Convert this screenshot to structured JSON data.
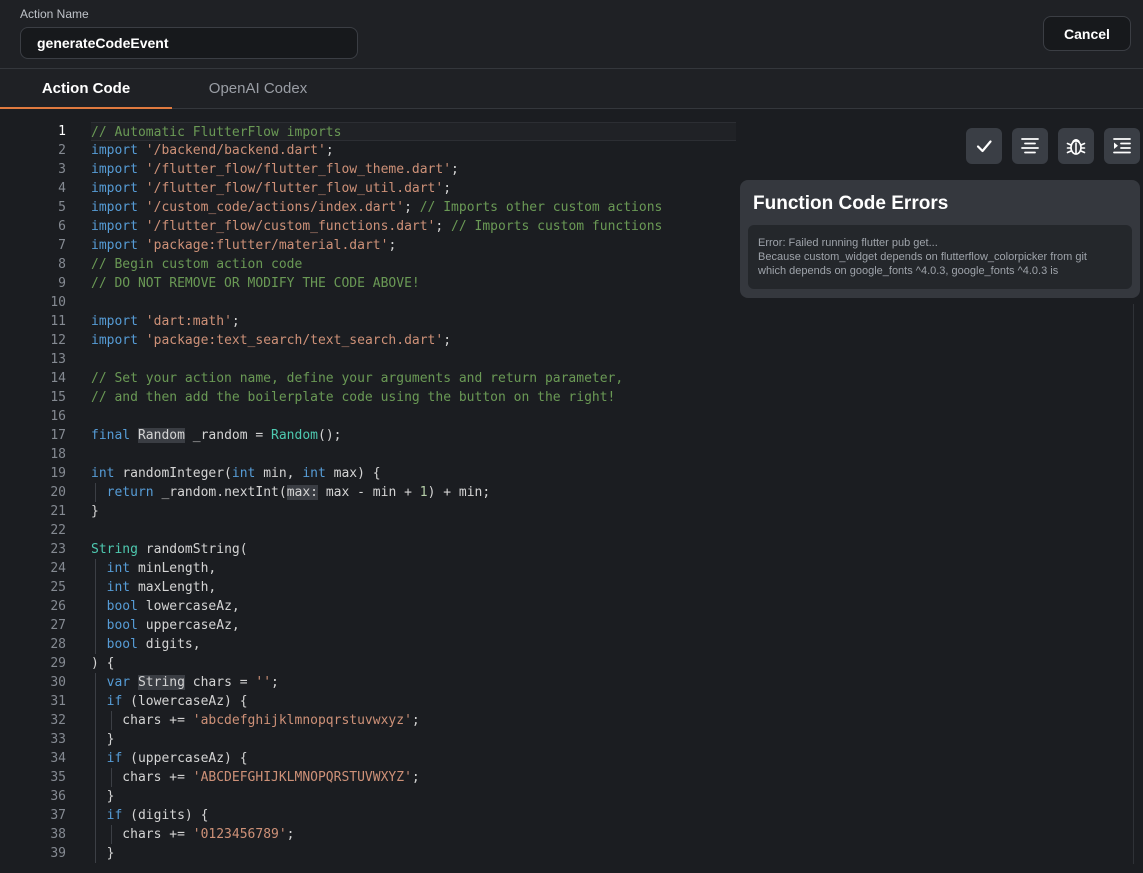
{
  "header": {
    "action_name_label": "Action Name",
    "action_name_value": "generateCodeEvent",
    "cancel_label": "Cancel"
  },
  "tabs": [
    {
      "label": "Action Code",
      "active": true
    },
    {
      "label": "OpenAI Codex",
      "active": false
    }
  ],
  "toolbar": {
    "icons": [
      "check-icon",
      "format-icon",
      "debug-icon",
      "indent-icon"
    ]
  },
  "errors": {
    "title": "Function Code Errors",
    "lines": [
      "Error: Failed running flutter pub get...",
      "Because custom_widget depends on flutterflow_colorpicker from git",
      "which depends on google_fonts ^4.0.3, google_fonts ^4.0.3 is"
    ]
  },
  "editor": {
    "active_line": 1,
    "lines": [
      [
        [
          "// Automatic FlutterFlow imports",
          "com"
        ]
      ],
      [
        [
          "import ",
          "kw"
        ],
        [
          "'/backend/backend.dart'",
          "str"
        ],
        [
          ";",
          ""
        ]
      ],
      [
        [
          "import ",
          "kw"
        ],
        [
          "'/flutter_flow/flutter_flow_theme.dart'",
          "str"
        ],
        [
          ";",
          ""
        ]
      ],
      [
        [
          "import ",
          "kw"
        ],
        [
          "'/flutter_flow/flutter_flow_util.dart'",
          "str"
        ],
        [
          ";",
          ""
        ]
      ],
      [
        [
          "import ",
          "kw"
        ],
        [
          "'/custom_code/actions/index.dart'",
          "str"
        ],
        [
          "; ",
          ""
        ],
        [
          "// Imports other custom actions",
          "com"
        ]
      ],
      [
        [
          "import ",
          "kw"
        ],
        [
          "'/flutter_flow/custom_functions.dart'",
          "str"
        ],
        [
          "; ",
          ""
        ],
        [
          "// Imports custom functions",
          "com"
        ]
      ],
      [
        [
          "import ",
          "kw"
        ],
        [
          "'package:flutter/material.dart'",
          "str"
        ],
        [
          ";",
          ""
        ]
      ],
      [
        [
          "// Begin custom action code",
          "com"
        ]
      ],
      [
        [
          "// DO NOT REMOVE OR MODIFY THE CODE ABOVE!",
          "com"
        ]
      ],
      [],
      [
        [
          "import ",
          "kw"
        ],
        [
          "'dart:math'",
          "str"
        ],
        [
          ";",
          ""
        ]
      ],
      [
        [
          "import ",
          "kw"
        ],
        [
          "'package:text_search/text_search.dart'",
          "str"
        ],
        [
          ";",
          ""
        ]
      ],
      [],
      [
        [
          "// Set your action name, define your arguments and return parameter,",
          "com"
        ]
      ],
      [
        [
          "// and then add the boilerplate code using the button on the right!",
          "com"
        ]
      ],
      [],
      [
        [
          "final ",
          "kw"
        ],
        [
          "Random",
          "hl"
        ],
        [
          " _random = ",
          ""
        ],
        [
          "Random",
          "type"
        ],
        [
          "();",
          ""
        ]
      ],
      [],
      [
        [
          "int ",
          "kw"
        ],
        [
          "randomInteger(",
          ""
        ],
        [
          "int ",
          "kw"
        ],
        [
          "min, ",
          ""
        ],
        [
          "int ",
          "kw"
        ],
        [
          "max) {",
          ""
        ]
      ],
      [
        [
          "  ",
          ""
        ],
        [
          "return ",
          "kw"
        ],
        [
          "_random.nextInt(",
          ""
        ],
        [
          "max:",
          "hl"
        ],
        [
          " max - min + ",
          ""
        ],
        [
          "1",
          "num"
        ],
        [
          ") + min;",
          ""
        ]
      ],
      [
        [
          "}",
          ""
        ]
      ],
      [],
      [
        [
          "String ",
          "type"
        ],
        [
          "randomString(",
          ""
        ]
      ],
      [
        [
          "  ",
          ""
        ],
        [
          "int ",
          "kw"
        ],
        [
          "minLength,",
          ""
        ]
      ],
      [
        [
          "  ",
          ""
        ],
        [
          "int ",
          "kw"
        ],
        [
          "maxLength,",
          ""
        ]
      ],
      [
        [
          "  ",
          ""
        ],
        [
          "bool ",
          "kw"
        ],
        [
          "lowercaseAz,",
          ""
        ]
      ],
      [
        [
          "  ",
          ""
        ],
        [
          "bool ",
          "kw"
        ],
        [
          "uppercaseAz,",
          ""
        ]
      ],
      [
        [
          "  ",
          ""
        ],
        [
          "bool ",
          "kw"
        ],
        [
          "digits,",
          ""
        ]
      ],
      [
        [
          ") {",
          ""
        ]
      ],
      [
        [
          "  ",
          ""
        ],
        [
          "var ",
          "kw"
        ],
        [
          "String",
          "hl"
        ],
        [
          " chars = ",
          ""
        ],
        [
          "''",
          "str"
        ],
        [
          ";",
          ""
        ]
      ],
      [
        [
          "  ",
          ""
        ],
        [
          "if ",
          "kw"
        ],
        [
          "(lowercaseAz) {",
          ""
        ]
      ],
      [
        [
          "    chars += ",
          ""
        ],
        [
          "'abcdefghijklmnopqrstuvwxyz'",
          "str"
        ],
        [
          ";",
          ""
        ]
      ],
      [
        [
          "  }",
          ""
        ]
      ],
      [
        [
          "  ",
          ""
        ],
        [
          "if ",
          "kw"
        ],
        [
          "(uppercaseAz) {",
          ""
        ]
      ],
      [
        [
          "    chars += ",
          ""
        ],
        [
          "'ABCDEFGHIJKLMNOPQRSTUVWXYZ'",
          "str"
        ],
        [
          ";",
          ""
        ]
      ],
      [
        [
          "  }",
          ""
        ]
      ],
      [
        [
          "  ",
          ""
        ],
        [
          "if ",
          "kw"
        ],
        [
          "(digits) {",
          ""
        ]
      ],
      [
        [
          "    chars += ",
          ""
        ],
        [
          "'0123456789'",
          "str"
        ],
        [
          ";",
          ""
        ]
      ],
      [
        [
          "  }",
          ""
        ]
      ]
    ]
  }
}
